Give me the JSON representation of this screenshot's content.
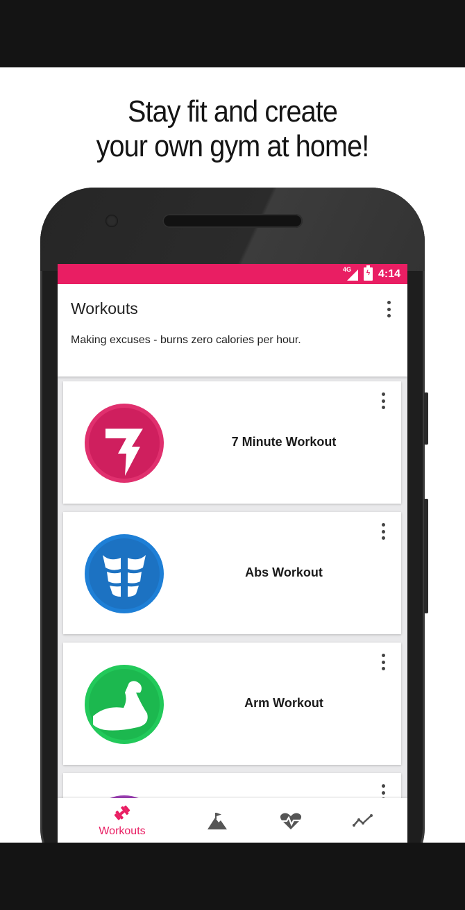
{
  "headline": {
    "line1": "Stay fit and create",
    "line2": "your own gym at home!"
  },
  "status_bar": {
    "network": "4G",
    "time": "4:14",
    "color": "#e91e63"
  },
  "header": {
    "title": "Workouts",
    "subtitle": "Making excuses - burns zero calories per hour.",
    "menu_icon": "more-vert-icon"
  },
  "workouts": [
    {
      "title": "7 Minute Workout",
      "icon": "lightning-bolt-icon",
      "color": "#e0306e"
    },
    {
      "title": "Abs Workout",
      "icon": "abs-icon",
      "color": "#1e7fd6"
    },
    {
      "title": "Arm Workout",
      "icon": "flexed-arm-icon",
      "color": "#22c95a"
    },
    {
      "title": "",
      "icon": "workout-icon",
      "color": "#9b3fb3"
    }
  ],
  "bottom_nav": {
    "active_color": "#e91e63",
    "items": [
      {
        "label": "Workouts",
        "icon": "dumbbell-icon",
        "active": true
      },
      {
        "label": "",
        "icon": "mountain-flag-icon",
        "active": false
      },
      {
        "label": "",
        "icon": "heart-rate-icon",
        "active": false
      },
      {
        "label": "",
        "icon": "trend-line-icon",
        "active": false
      }
    ]
  }
}
